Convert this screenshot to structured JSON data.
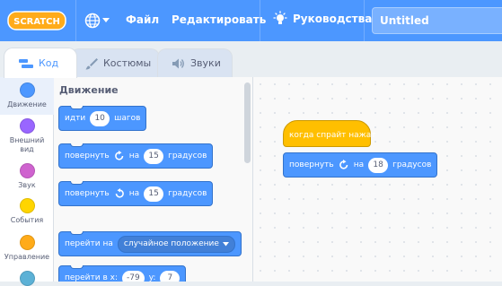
{
  "menubar": {
    "logo_text": "SCRATCH",
    "file_label": "Файл",
    "edit_label": "Редактировать",
    "tutorials_label": "Руководства",
    "project_title": "Untitled"
  },
  "tabs": {
    "code_label": "Код",
    "costumes_label": "Костюмы",
    "sounds_label": "Звуки"
  },
  "categories": [
    {
      "label": "Движение",
      "color": "#4c97ff"
    },
    {
      "label": "Внешний вид",
      "color": "#9966ff"
    },
    {
      "label": "Звук",
      "color": "#cf63cf"
    },
    {
      "label": "События",
      "color": "#ffd500"
    },
    {
      "label": "Управление",
      "color": "#ffab19"
    },
    {
      "label": "",
      "color": "#5cb1d6"
    }
  ],
  "palette": {
    "heading": "Движение",
    "move": {
      "text1": "идти",
      "value": "10",
      "text2": "шагов"
    },
    "turn_right": {
      "text1": "повернуть",
      "text2": "на",
      "value": "15",
      "text3": "градусов"
    },
    "turn_left": {
      "text1": "повернуть",
      "text2": "на",
      "value": "15",
      "text3": "градусов"
    },
    "goto": {
      "text1": "перейти на",
      "option": "случайное положение"
    },
    "goto_xy": {
      "text1": "перейти в x:",
      "x": "-79",
      "text2": "y:",
      "y": "7"
    }
  },
  "canvas": {
    "hat_text": "когда спрайт нажат",
    "turn": {
      "text1": "повернуть",
      "text2": "на",
      "value": "18",
      "text3": "градусов"
    }
  },
  "colors": {
    "motion": "#4c97ff",
    "events": "#ffbf00",
    "menubar": "#4c97ff"
  }
}
